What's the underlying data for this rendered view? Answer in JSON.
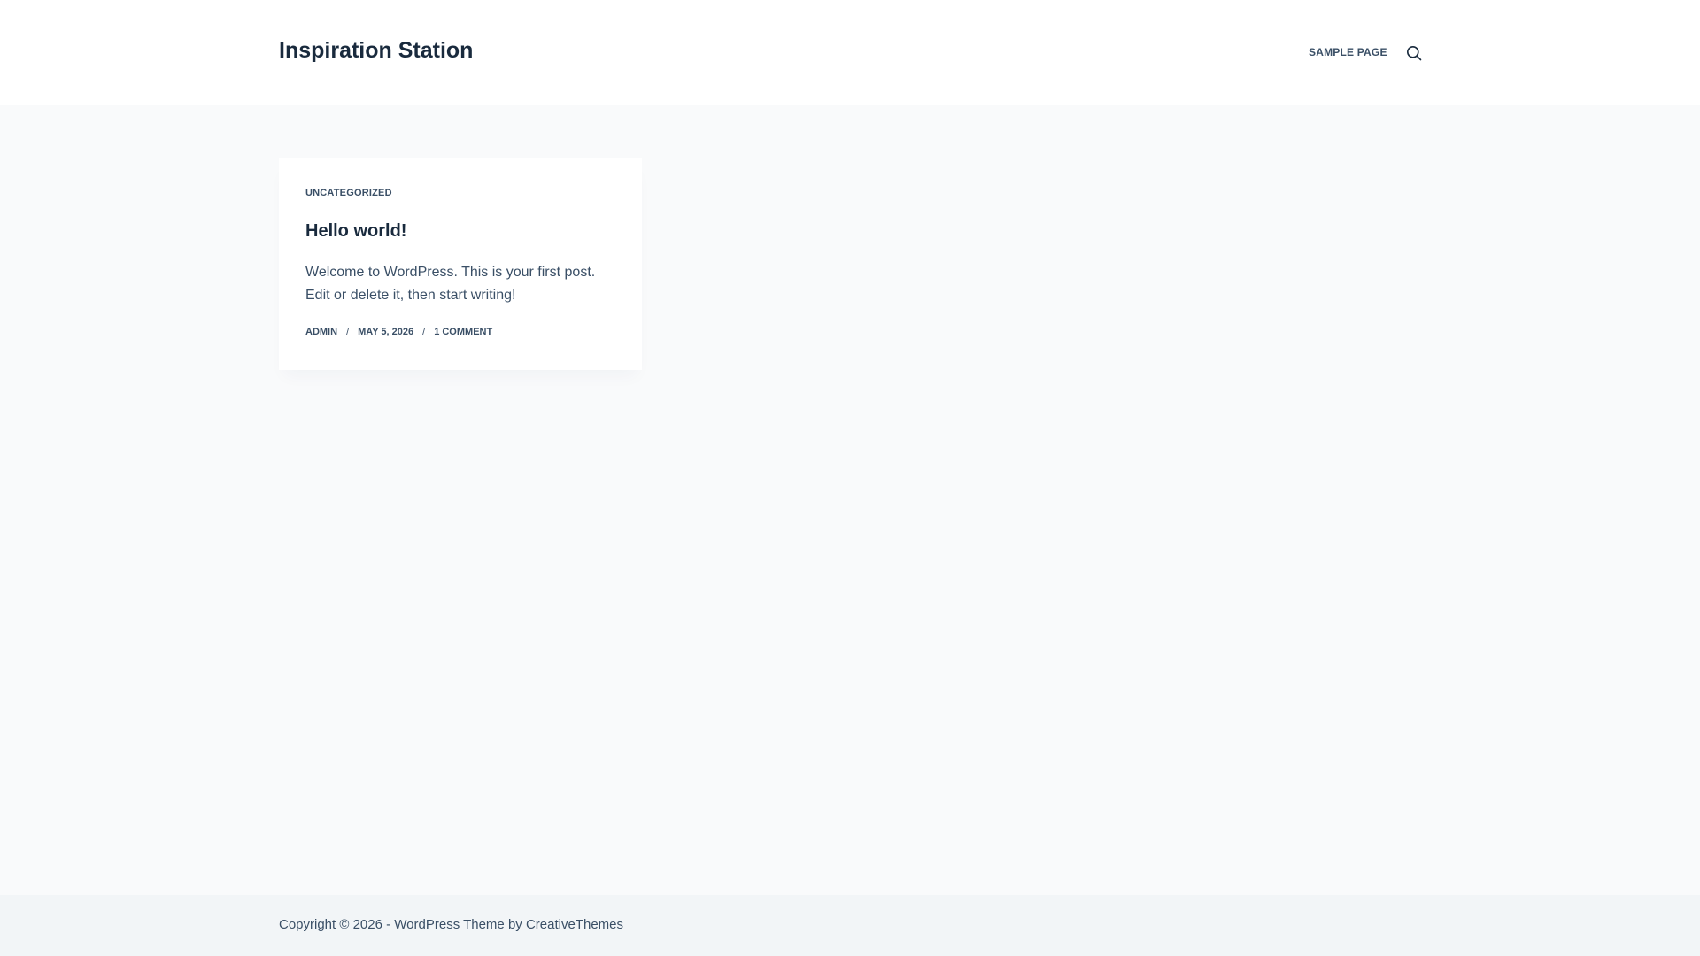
{
  "header": {
    "site_title": "Inspiration Station",
    "nav": [
      {
        "label": "SAMPLE PAGE"
      }
    ],
    "search_icon": "search-icon"
  },
  "post": {
    "category": "UNCATEGORIZED",
    "title": "Hello world!",
    "excerpt": "Welcome to WordPress. This is your first post. Edit or delete it, then start writing!",
    "meta": {
      "author": "ADMIN",
      "separator": "/",
      "date": "MAY 5, 2026",
      "comments": "1 COMMENT"
    }
  },
  "footer": {
    "copyright_prefix": "Copyright © 2026 - WordPress Theme by ",
    "theme_author": "CreativeThemes"
  },
  "colors": {
    "heading": "#192a3d",
    "text": "#3a4f66",
    "page_background": "#f9fafb",
    "header_background": "#ffffff",
    "footer_background": "#f2f5f7"
  }
}
